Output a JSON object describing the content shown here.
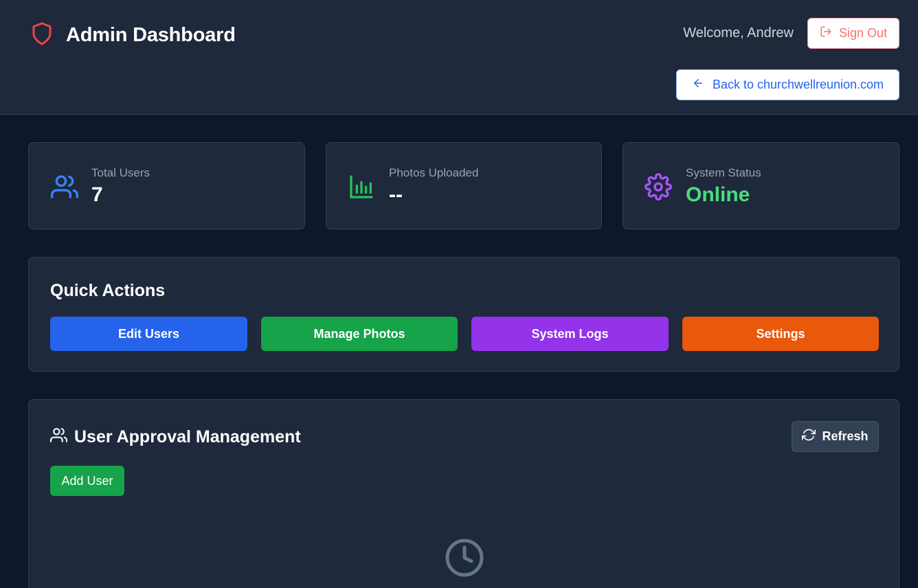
{
  "header": {
    "title": "Admin Dashboard",
    "brand_icon": "shield-icon",
    "welcome": "Welcome, Andrew",
    "sign_out_label": "Sign Out",
    "back_link_label": "Back to churchwellreunion.com"
  },
  "stats": [
    {
      "label": "Total Users",
      "value": "7",
      "icon": "users-icon",
      "color": "#3b82f6"
    },
    {
      "label": "Photos Uploaded",
      "value": "--",
      "icon": "bar-chart-icon",
      "color": "#22c55e"
    },
    {
      "label": "System Status",
      "value": "Online",
      "icon": "gear-icon",
      "color": "#a855f7",
      "value_color": "#4ade80"
    }
  ],
  "quick_actions": {
    "title": "Quick Actions",
    "buttons": [
      {
        "label": "Edit Users",
        "color": "#2563eb"
      },
      {
        "label": "Manage Photos",
        "color": "#16a34a"
      },
      {
        "label": "System Logs",
        "color": "#9333ea"
      },
      {
        "label": "Settings",
        "color": "#ea580c"
      }
    ]
  },
  "user_approval": {
    "title": "User Approval Management",
    "refresh_label": "Refresh",
    "add_user_label": "Add User",
    "empty_icon": "clock-icon"
  },
  "colors": {
    "page_bg": "#0f172a",
    "panel_bg": "#1e293b",
    "border": "#334155",
    "danger": "#f87171",
    "link": "#2563eb"
  }
}
